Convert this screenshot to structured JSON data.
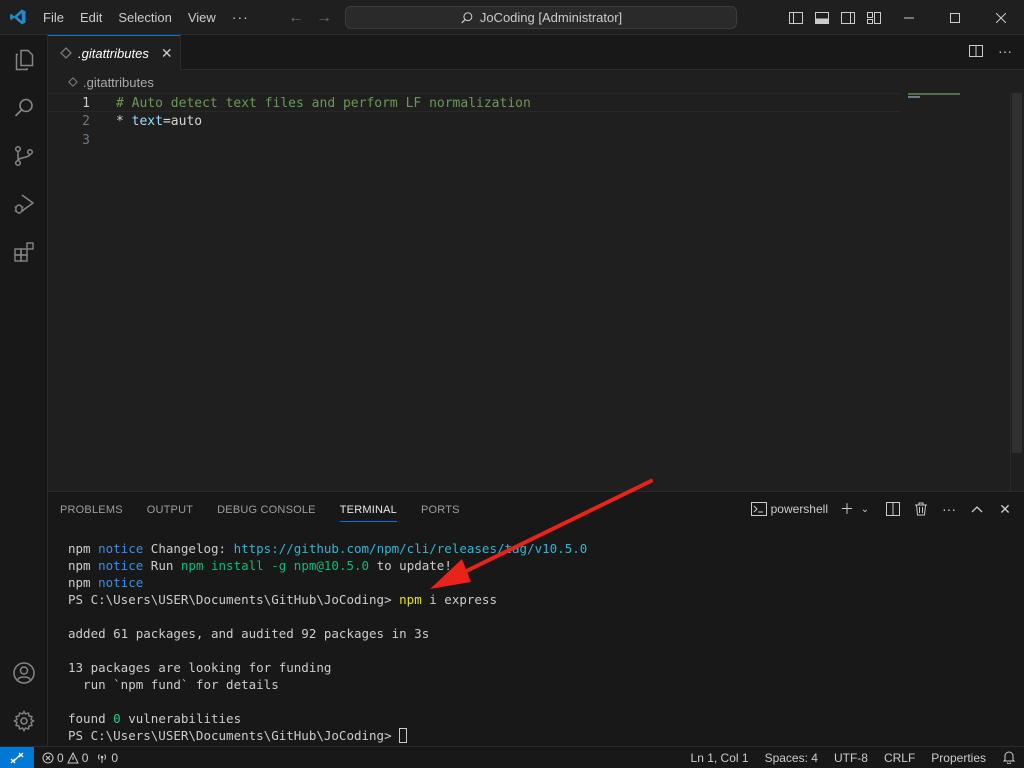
{
  "titlebar": {
    "menu": [
      "File",
      "Edit",
      "Selection",
      "View"
    ],
    "more": "···",
    "command_center": "JoCoding [Administrator]"
  },
  "tab": {
    "label": ".gitattributes"
  },
  "breadcrumb": {
    "file": ".gitattributes"
  },
  "editor": {
    "line_numbers": [
      "1",
      "2",
      "3"
    ],
    "line1": "# Auto detect text files and perform LF normalization",
    "line2_star": "* ",
    "line2_key": "text",
    "line2_rest": "=auto"
  },
  "panel": {
    "tabs": [
      "PROBLEMS",
      "OUTPUT",
      "DEBUG CONSOLE",
      "TERMINAL",
      "PORTS"
    ],
    "active_tab": "TERMINAL",
    "terminal_name": "powershell"
  },
  "terminal": {
    "l1_a": "npm ",
    "l1_b": "notice",
    "l1_c": " Changelog: ",
    "l1_d": "https://github.com/npm/cli/releases/tag/v10.5.0",
    "l2_a": "npm ",
    "l2_b": "notice",
    "l2_c": " Run ",
    "l2_d": "npm install -g npm@10.5.0",
    "l2_e": " to update!",
    "l3_a": "npm ",
    "l3_b": "notice",
    "l4_a": "PS C:\\Users\\USER\\Documents\\GitHub\\JoCoding> ",
    "l4_b": "npm",
    "l4_c": " i express",
    "l5": "added 61 packages, and audited 92 packages in 3s",
    "l6": "13 packages are looking for funding",
    "l7": "  run `npm fund` for details",
    "l8_a": "found ",
    "l8_b": "0",
    "l8_c": " vulnerabilities",
    "l9": "PS C:\\Users\\USER\\Documents\\GitHub\\JoCoding> "
  },
  "statusbar": {
    "errors": "0",
    "warnings": "0",
    "ports": "0",
    "position": "Ln 1, Col 1",
    "spaces": "Spaces: 4",
    "encoding": "UTF-8",
    "eol": "CRLF",
    "properties": "Properties"
  },
  "colors": {
    "accent": "#0078d4",
    "annotation_arrow": "#e8231c"
  }
}
